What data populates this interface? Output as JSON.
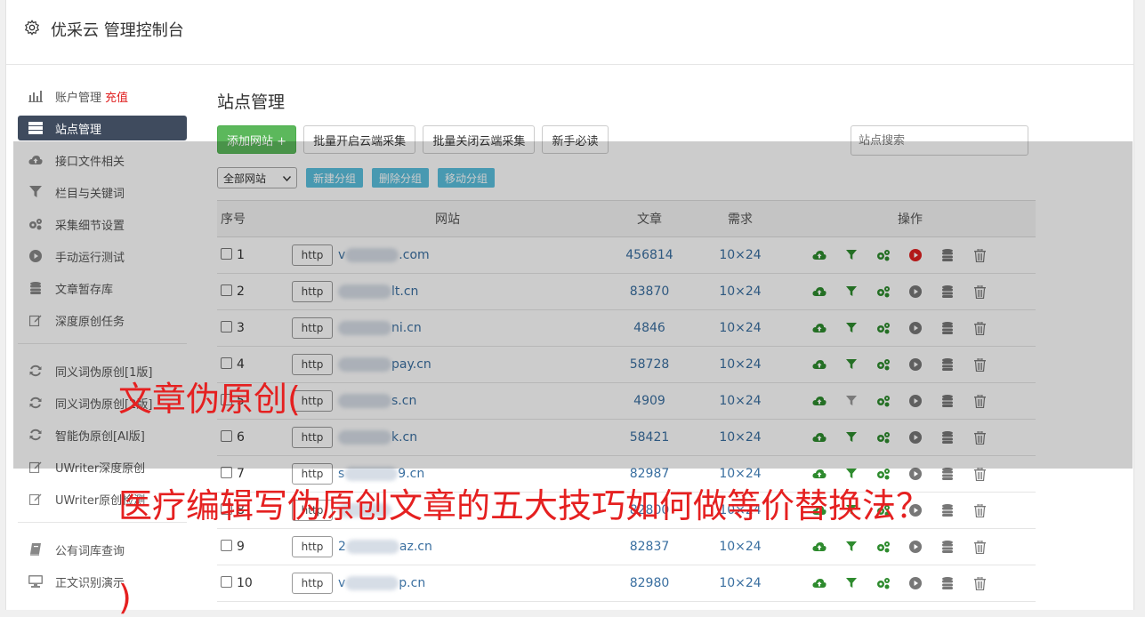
{
  "app": {
    "title": "优采云 管理控制台"
  },
  "sidebar": {
    "items": [
      {
        "label": "账户管理",
        "extra": "充值",
        "icon": "bar-chart-icon"
      },
      {
        "label": "站点管理",
        "icon": "server-icon",
        "active": true
      },
      {
        "label": "接口文件相关",
        "icon": "cloud-upload-icon"
      },
      {
        "label": "栏目与关键词",
        "icon": "filter-icon"
      },
      {
        "label": "采集细节设置",
        "icon": "gears-icon"
      },
      {
        "label": "手动运行测试",
        "icon": "play-circle-icon"
      },
      {
        "label": "文章暂存库",
        "icon": "database-icon"
      },
      {
        "label": "深度原创任务",
        "icon": "edit-icon"
      }
    ],
    "items2": [
      {
        "label": "同义词伪原创[1版]",
        "icon": "refresh-icon"
      },
      {
        "label": "同义词伪原创[2版]",
        "icon": "refresh-icon"
      },
      {
        "label": "智能伪原创[AI版]",
        "icon": "refresh-icon"
      },
      {
        "label": "UWriter深度原创",
        "icon": "edit-icon"
      },
      {
        "label": "UWriter原创检测",
        "icon": "edit-icon"
      }
    ],
    "items3": [
      {
        "label": "公有词库查询",
        "icon": "book-icon"
      },
      {
        "label": "正文识别演示",
        "icon": "monitor-icon"
      }
    ]
  },
  "main": {
    "title": "站点管理",
    "buttons": {
      "add": "添加网站 +",
      "batch_open": "批量开启云端采集",
      "batch_close": "批量关闭云端采集",
      "newbie": "新手必读"
    },
    "search_placeholder": "站点搜索",
    "group_select": "全部网站",
    "group_buttons": {
      "new": "新建分组",
      "delete": "删除分组",
      "move": "移动分组"
    },
    "table": {
      "headers": {
        "num": "序号",
        "site": "网站",
        "article": "文章",
        "demand": "需求",
        "ops": "操作"
      },
      "rows": [
        {
          "num": "1",
          "scheme": "http",
          "site_prefix": "v",
          "site_suffix": ".com",
          "article": "456814",
          "demand": "10×24",
          "running": true,
          "filter_on": true
        },
        {
          "num": "2",
          "scheme": "http",
          "site_prefix": "",
          "site_suffix": "lt.cn",
          "article": "83870",
          "demand": "10×24",
          "running": false,
          "filter_on": true
        },
        {
          "num": "3",
          "scheme": "http",
          "site_prefix": "",
          "site_suffix": "ni.cn",
          "article": "4846",
          "demand": "10×24",
          "running": false,
          "filter_on": true
        },
        {
          "num": "4",
          "scheme": "http",
          "site_prefix": "",
          "site_suffix": "pay.cn",
          "article": "58728",
          "demand": "10×24",
          "running": false,
          "filter_on": true
        },
        {
          "num": "5",
          "scheme": "http",
          "site_prefix": "",
          "site_suffix": "s.cn",
          "article": "4909",
          "demand": "10×24",
          "running": false,
          "filter_on": false
        },
        {
          "num": "6",
          "scheme": "http",
          "site_prefix": "",
          "site_suffix": "k.cn",
          "article": "58421",
          "demand": "10×24",
          "running": false,
          "filter_on": true
        },
        {
          "num": "7",
          "scheme": "http",
          "site_prefix": "s",
          "site_suffix": "9.cn",
          "article": "82987",
          "demand": "10×24",
          "running": false,
          "filter_on": true
        },
        {
          "num": "8",
          "scheme": "http",
          "site_prefix": "",
          "site_suffix": "",
          "article": "82800",
          "demand": "10×24",
          "running": false,
          "filter_on": true
        },
        {
          "num": "9",
          "scheme": "http",
          "site_prefix": "2",
          "site_suffix": "az.cn",
          "article": "82837",
          "demand": "10×24",
          "running": false,
          "filter_on": true
        },
        {
          "num": "10",
          "scheme": "http",
          "site_prefix": "v",
          "site_suffix": "p.cn",
          "article": "82980",
          "demand": "10×24",
          "running": false,
          "filter_on": true
        }
      ]
    }
  },
  "overlay": {
    "line1": "文章伪原创(",
    "line2": "医疗编辑写伪原创文章的五大技巧如何做等价替换法？",
    "line3": ")"
  },
  "colors": {
    "green": "#5cb85c",
    "info": "#5bc0de",
    "active_nav": "#3f4b5e",
    "red_text": "#e52020",
    "link": "#3a6fa0"
  }
}
